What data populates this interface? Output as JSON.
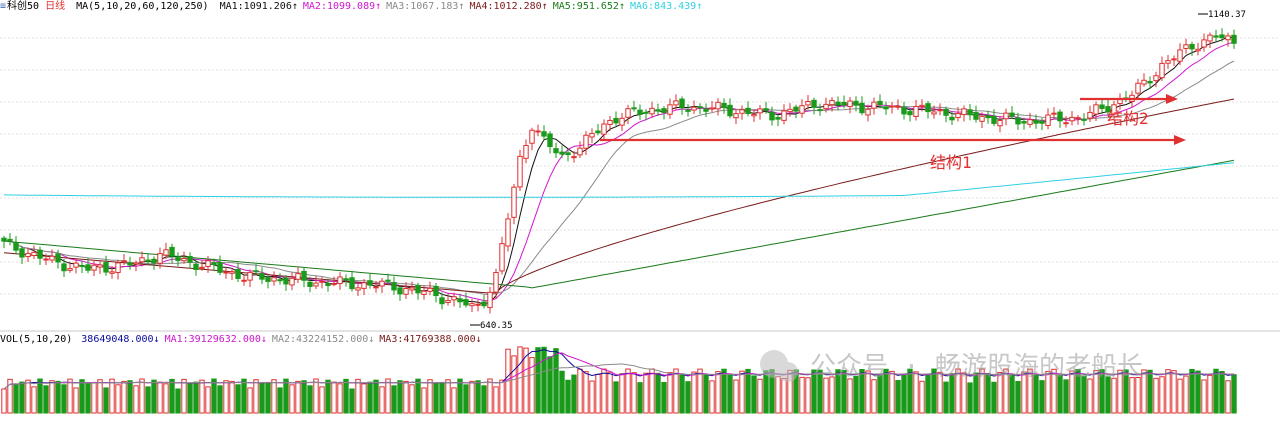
{
  "price_legend": {
    "title": "科创50",
    "period": "日线",
    "ma_params": "MA(5,10,20,60,120,250)",
    "items": [
      {
        "label": "MA1:",
        "value": "1091.206",
        "trend": "↑",
        "color": "#101010"
      },
      {
        "label": "MA2:",
        "value": "1099.089",
        "trend": "↑",
        "color": "#d017d0"
      },
      {
        "label": "MA3:",
        "value": "1067.183",
        "trend": "↑",
        "color": "#8a8a8a"
      },
      {
        "label": "MA4:",
        "value": "1012.280",
        "trend": "↑",
        "color": "#7a1a1a"
      },
      {
        "label": "MA5:",
        "value": "951.652",
        "trend": "↑",
        "color": "#1a7a1a"
      },
      {
        "label": "MA6:",
        "value": "843.439",
        "trend": "↑",
        "color": "#30d0e0"
      }
    ]
  },
  "volume_legend": {
    "title": "VOL(5,10,20)",
    "items": [
      {
        "label": "",
        "value": "38649048.000",
        "trend": "↓",
        "color": "#0a0aa0"
      },
      {
        "label": "MA1:",
        "value": "39129632.000",
        "trend": "↓",
        "color": "#d017d0"
      },
      {
        "label": "MA2:",
        "value": "43224152.000",
        "trend": "↓",
        "color": "#8a8a8a"
      },
      {
        "label": "MA3:",
        "value": "41769388.000",
        "trend": "↓",
        "color": "#7a1a1a"
      }
    ]
  },
  "annotations": {
    "high_label": "1140.37",
    "low_label": "640.35",
    "structure1": "结构1",
    "structure2": "结构2",
    "watermark": "公众号 · 畅游股海的老船长"
  },
  "colors": {
    "up": "#e03030",
    "down": "#1a9a1a",
    "grid": "#d8d8d8",
    "arrow": "#e03030"
  },
  "chart_data": {
    "type": "candlestick",
    "title": "科创50 日线",
    "y_range": [
      640.35,
      1140.37
    ],
    "ohlc_sample": [
      {
        "label": "low",
        "value": 640.35
      },
      {
        "label": "high",
        "value": 1140.37
      }
    ],
    "moving_averages": [
      "MA5",
      "MA10",
      "MA20",
      "MA60",
      "MA120",
      "MA250"
    ],
    "volume": {
      "ma": [
        "MA5",
        "MA10",
        "MA20"
      ]
    }
  }
}
